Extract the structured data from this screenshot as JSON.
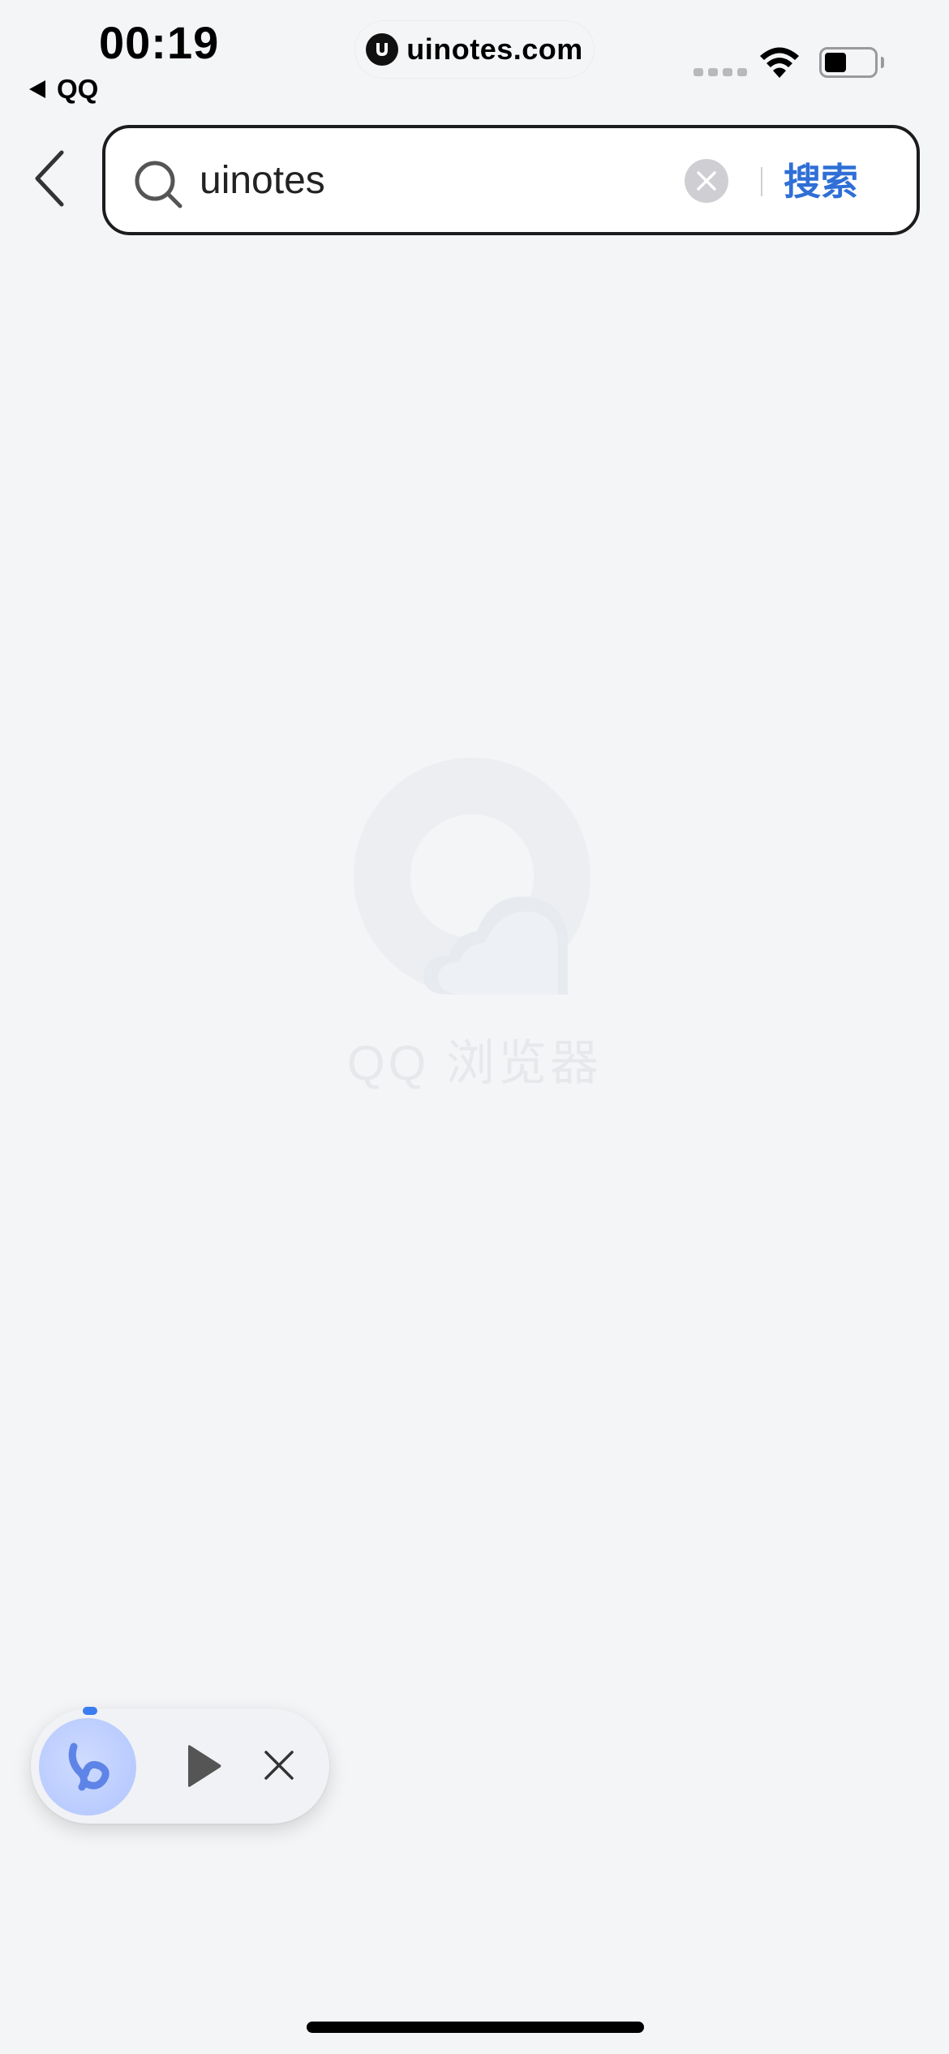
{
  "status_bar": {
    "time": "00:19",
    "back_app": "QQ",
    "url": "uinotes.com",
    "site_logo_icon": "uinotes-logo-icon"
  },
  "search_bar": {
    "query": "uinotes",
    "search_button": "搜索"
  },
  "watermark": {
    "text": "QQ 浏览器"
  },
  "floating_player": {
    "avatar_icon": "audio-assistant-icon",
    "play_icon": "play-icon",
    "close_icon": "close-icon"
  },
  "colors": {
    "background": "#f4f5f7",
    "accent": "#2f6fd6",
    "player_avatar": "#b9cbff"
  }
}
